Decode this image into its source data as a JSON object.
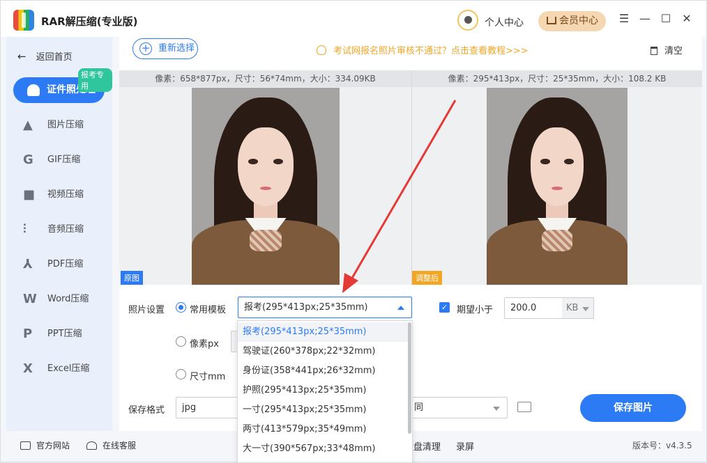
{
  "app": {
    "title": "RAR解压缩(专业版)"
  },
  "header": {
    "user_center": "个人中心",
    "vip": "会员中心",
    "minimize": "—",
    "maximize": "☐",
    "close": "✕",
    "menu": "☰"
  },
  "sidebar": {
    "back": "返回首页",
    "active_badge": "报考专用",
    "items": [
      {
        "label": "证件照处理",
        "icon": "person-id-icon"
      },
      {
        "label": "图片压缩",
        "icon": "image-icon"
      },
      {
        "label": "GIF压缩",
        "icon": "gif-icon"
      },
      {
        "label": "视频压缩",
        "icon": "video-icon"
      },
      {
        "label": "音频压缩",
        "icon": "audio-icon"
      },
      {
        "label": "PDF压缩",
        "icon": "pdf-icon"
      },
      {
        "label": "Word压缩",
        "icon": "word-icon"
      },
      {
        "label": "PPT压缩",
        "icon": "ppt-icon"
      },
      {
        "label": "Excel压缩",
        "icon": "excel-icon"
      }
    ]
  },
  "toolbar": {
    "reselect": "重新选择",
    "tip": "考试网报名照片审核不通过？点击查看教程>>>",
    "clear": "清空"
  },
  "original": {
    "info": "像素：658*877px，尺寸：56*74mm，大小：334.09KB",
    "tag": "原图"
  },
  "adjusted": {
    "info": "像素：295*413px，尺寸：25*35mm，大小：108.2 KB",
    "tag": "调整后"
  },
  "settings": {
    "photo_settings": "照片设置",
    "template_label": "常用模板",
    "template_value": "报考(295*413px;25*35mm)",
    "pixel_label": "像素px",
    "size_label": "尺寸mm",
    "expect_label": "期望小于",
    "expect_value": "200.0",
    "unit": "KB",
    "save_format": "保存格式",
    "format_value": "jpg",
    "output_value": "同",
    "save_button": "保存图片"
  },
  "dropdown": {
    "options": [
      "报考(295*413px;25*35mm)",
      "驾驶证(260*378px;22*32mm)",
      "身份证(358*441px;26*32mm)",
      "护照(295*413px;25*35mm)",
      "一寸(295*413px;25*35mm)",
      "两寸(413*579px;35*49mm)",
      "大一寸(390*567px;33*48mm)"
    ]
  },
  "footer": {
    "website": "官方网站",
    "service": "在线客服",
    "disk_clean": "盘清理",
    "record": "录屏",
    "version": "版本号：v4.3.5"
  },
  "colors": {
    "accent": "#2d7bf4",
    "tip": "#f1a626",
    "vip_bg": "#f5d7b2",
    "badge": "#2fc59d",
    "arrow": "#e53935"
  }
}
